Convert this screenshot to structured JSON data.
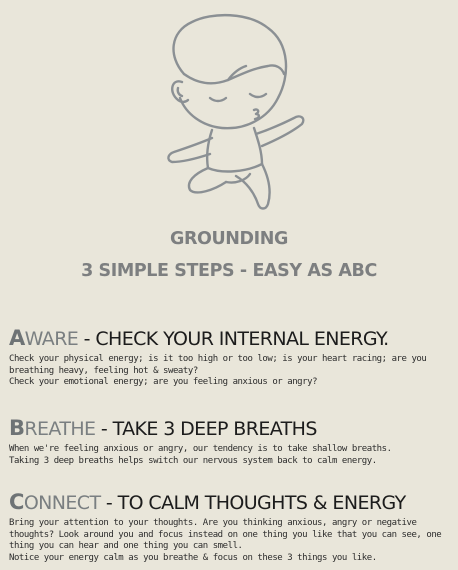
{
  "header": {
    "title": "GROUNDING",
    "subtitle": "3 SIMPLE STEPS -  EASY AS ABC"
  },
  "illustration": {
    "icon": "meditating-child-icon",
    "line_color": "#8b9094"
  },
  "colors": {
    "background": "#e9e6da",
    "title": "#7d7f80",
    "accent": "#6e7375",
    "text": "#222222"
  },
  "sections": [
    {
      "letter": "A",
      "word_rest": "WARE",
      "rest": " - CHECK YOUR INTERNAL ENERGY.",
      "lines": [
        "Check your physical energy; is it too high or too low; is your heart racing; are you breathing heavy, feeling hot & sweaty?",
        "Check your emotional energy; are you feeling anxious or angry?"
      ]
    },
    {
      "letter": "B",
      "word_rest": "REATHE",
      "rest": " - TAKE 3 DEEP BREATHS",
      "lines": [
        "When we're feeling anxious or angry, our tendency is to take shallow breaths.",
        "Taking 3 deep breaths helps switch our nervous system back to calm energy."
      ]
    },
    {
      "letter": "C",
      "word_rest": "ONNECT",
      "rest": " - TO CALM THOUGHTS & ENERGY",
      "lines": [
        "Bring your attention to your thoughts.  Are you thinking anxious, angry or negative thoughts?  Look around you and focus instead on one thing you like that you can see, one thing you can hear and one thing you can smell.",
        "Notice your energy calm as you breathe & focus on these 3 things you like."
      ]
    }
  ]
}
